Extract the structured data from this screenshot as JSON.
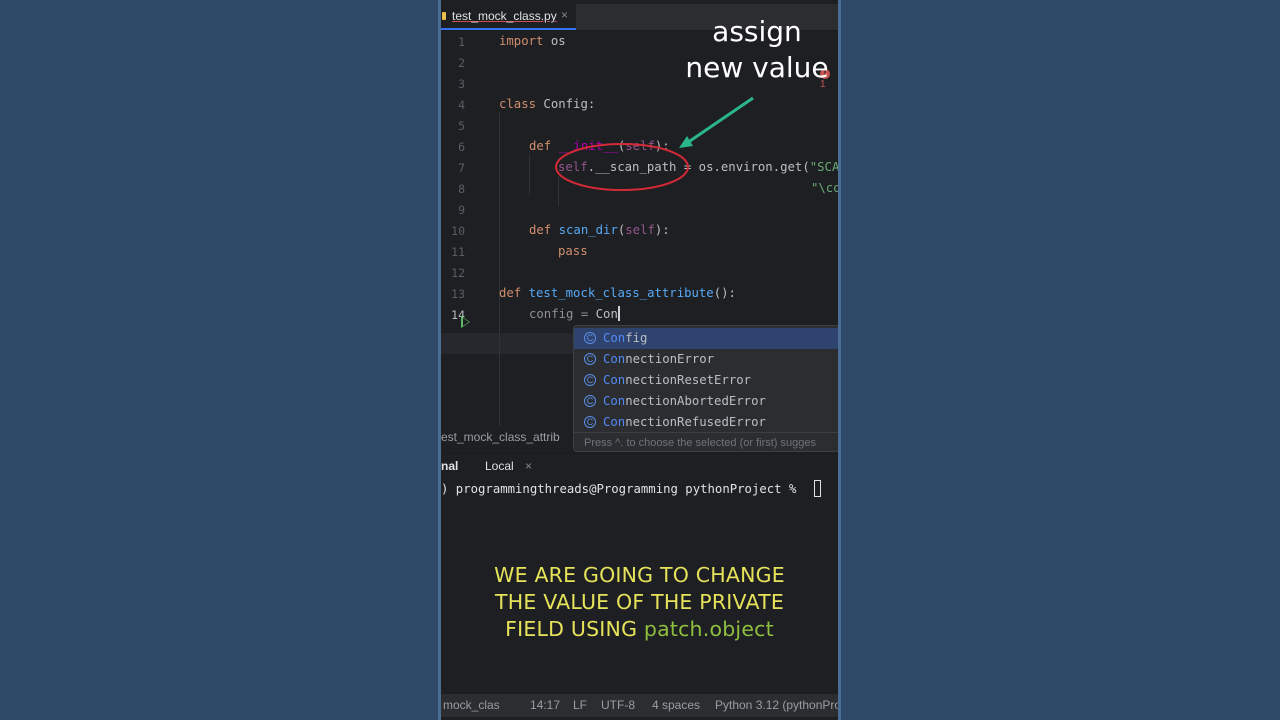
{
  "tab": {
    "filename": "test_mock_class.py",
    "close": "×"
  },
  "editor": {
    "line_numbers": [
      "1",
      "2",
      "3",
      "4",
      "5",
      "6",
      "7",
      "8",
      "9",
      "10",
      "11",
      "12",
      "13",
      "14"
    ],
    "lines": {
      "l1": [
        "import",
        " os"
      ],
      "l4": [
        "class",
        " Config:"
      ],
      "l6": [
        "def",
        " __init__",
        "(",
        "self",
        "):"
      ],
      "l7": [
        "self",
        ".__scan_path = os.environ.get(",
        "\"SCA"
      ],
      "l8": [
        "\"\\co"
      ],
      "l10": [
        "def",
        " ",
        "scan_dir",
        "(",
        "self",
        "):"
      ],
      "l11": [
        "pass"
      ],
      "l13": [
        "def",
        " ",
        "test_mock_class_attribute",
        "():"
      ],
      "l14": [
        "config = ",
        "Con"
      ]
    },
    "error_count": "1"
  },
  "annotation": {
    "line1": "assign",
    "line2": "new value",
    "color": "#ffffff",
    "arrow_color": "#2bb58a",
    "circle_color": "#d42a37"
  },
  "autocomplete": {
    "icon_letter": "C",
    "typed": "Con",
    "items": [
      {
        "match": "Con",
        "rest": "fig"
      },
      {
        "match": "Con",
        "rest": "nectionError"
      },
      {
        "match": "Con",
        "rest": "nectionResetError"
      },
      {
        "match": "Con",
        "rest": "nectionAbortedError"
      },
      {
        "match": "Con",
        "rest": "nectionRefusedError"
      }
    ],
    "hint": "Press ^. to choose the selected (or first) sugges"
  },
  "breadcrumb": "est_mock_class_attrib",
  "terminal": {
    "tab_left": "nal",
    "tab_local": "Local",
    "tab_close": "×",
    "prompt": ") programmingthreads@Programming pythonProject % "
  },
  "caption": {
    "line1": "WE ARE GOING TO CHANGE",
    "line2": "THE VALUE OF THE PRIVATE",
    "line3_start": "FIELD USING ",
    "line3_highlight": "patch.object"
  },
  "statusbar": {
    "file": "mock_clas",
    "position": "14:17",
    "line_sep": "LF",
    "encoding": "UTF-8",
    "indent": "4 spaces",
    "interpreter": "Python 3.12 (pythonPro"
  }
}
